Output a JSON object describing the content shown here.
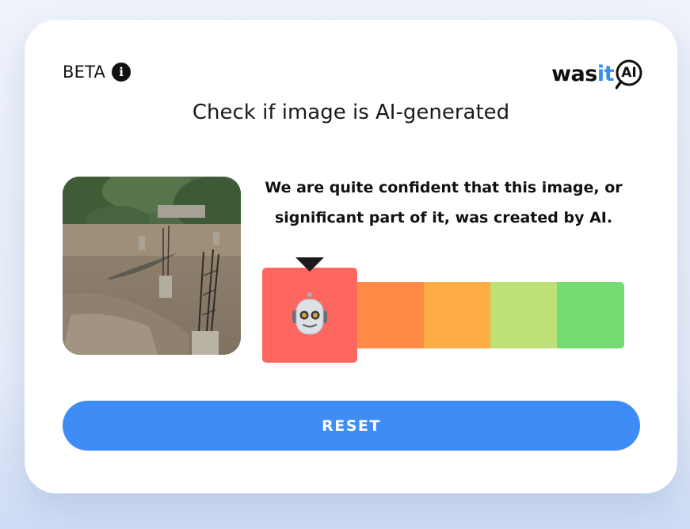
{
  "header": {
    "beta_label": "BETA",
    "info_icon": "info-icon",
    "logo": {
      "part1": "was",
      "part2": "it",
      "part3": "AI",
      "accent_color": "#3b8df6"
    }
  },
  "main": {
    "title": "Check if image is AI-generated",
    "verdict": "We are quite confident that this image, or significant part of it, was created by AI.",
    "image_description": "uploaded image thumbnail: flooded area with crocodile and concrete pillars",
    "meter": {
      "selected_level": 1,
      "level_count": 5,
      "selected_icon": "robot-icon",
      "colors": [
        "#fe6760",
        "#ff8b46",
        "#ffae46",
        "#bfdf77",
        "#75dc74"
      ]
    },
    "reset_label": "RESET",
    "reset_color": "#3e8df7"
  }
}
